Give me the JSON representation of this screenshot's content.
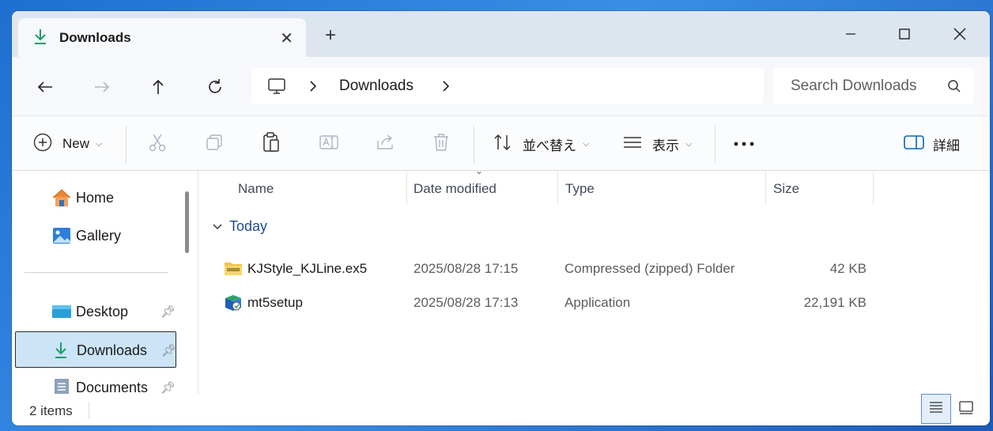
{
  "tab": {
    "title": "Downloads"
  },
  "address": {
    "segment": "Downloads"
  },
  "search": {
    "placeholder": "Search Downloads"
  },
  "toolbar": {
    "new_label": "New",
    "sort_label": "並べ替え",
    "view_label": "表示",
    "details_label": "詳細"
  },
  "sidebar": {
    "items": [
      {
        "label": "Home"
      },
      {
        "label": "Gallery"
      },
      {
        "label": "Desktop"
      },
      {
        "label": "Downloads"
      },
      {
        "label": "Documents"
      }
    ]
  },
  "columns": {
    "name": "Name",
    "date": "Date modified",
    "type": "Type",
    "size": "Size"
  },
  "group": {
    "label": "Today"
  },
  "files": [
    {
      "name": "KJStyle_KJLine.ex5",
      "date": "2025/08/28 17:15",
      "type": "Compressed (zipped) Folder",
      "size": "42 KB",
      "icon": "zip-folder-icon"
    },
    {
      "name": "mt5setup",
      "date": "2025/08/28 17:13",
      "type": "Application",
      "size": "22,191 KB",
      "icon": "installer-app-icon"
    }
  ],
  "status": {
    "count": "2 items"
  },
  "colors": {
    "accent": "#0067c0",
    "selection": "#cce4f7",
    "download_green": "#1a9e6a"
  }
}
